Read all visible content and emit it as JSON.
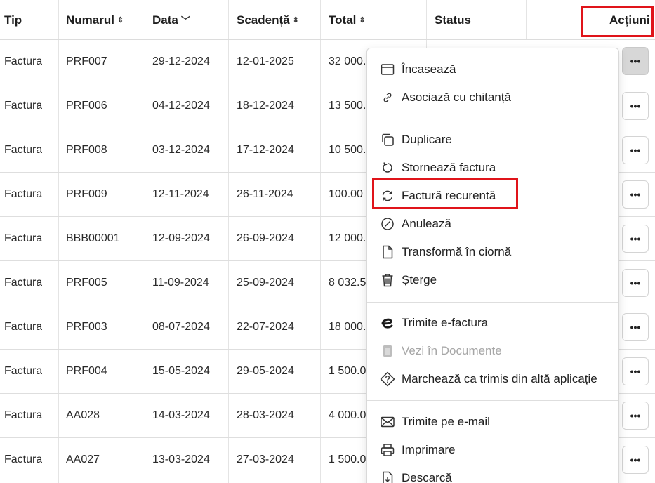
{
  "columns": {
    "tip": "Tip",
    "numarul": "Numarul",
    "data": "Data",
    "scadenta": "Scadență",
    "total": "Total",
    "status": "Status",
    "actiuni": "Acțiuni"
  },
  "rows": [
    {
      "tip": "Factura",
      "numar": "PRF007",
      "data": "29-12-2024",
      "scadenta": "12-01-2025",
      "total": "32 000."
    },
    {
      "tip": "Factura",
      "numar": "PRF006",
      "data": "04-12-2024",
      "scadenta": "18-12-2024",
      "total": "13 500."
    },
    {
      "tip": "Factura",
      "numar": "PRF008",
      "data": "03-12-2024",
      "scadenta": "17-12-2024",
      "total": "10 500."
    },
    {
      "tip": "Factura",
      "numar": "PRF009",
      "data": "12-11-2024",
      "scadenta": "26-11-2024",
      "total": "100.00"
    },
    {
      "tip": "Factura",
      "numar": "BBB00001",
      "data": "12-09-2024",
      "scadenta": "26-09-2024",
      "total": "12 000."
    },
    {
      "tip": "Factura",
      "numar": "PRF005",
      "data": "11-09-2024",
      "scadenta": "25-09-2024",
      "total": "8 032.5"
    },
    {
      "tip": "Factura",
      "numar": "PRF003",
      "data": "08-07-2024",
      "scadenta": "22-07-2024",
      "total": "18 000."
    },
    {
      "tip": "Factura",
      "numar": "PRF004",
      "data": "15-05-2024",
      "scadenta": "29-05-2024",
      "total": "1 500.0"
    },
    {
      "tip": "Factura",
      "numar": "AA028",
      "data": "14-03-2024",
      "scadenta": "28-03-2024",
      "total": "4 000.0"
    },
    {
      "tip": "Factura",
      "numar": "AA027",
      "data": "13-03-2024",
      "scadenta": "27-03-2024",
      "total": "1 500.0"
    }
  ],
  "row_actions_label": "•••",
  "menu": {
    "incaseaza": "Încasează",
    "asociaza": "Asociază cu chitanță",
    "duplicare": "Duplicare",
    "storneaza": "Stornează factura",
    "recurenta": "Factură recurentă",
    "anuleaza": "Anulează",
    "transforma": "Transformă în ciornă",
    "sterge": "Șterge",
    "efactura": "Trimite e-factura",
    "vezi_documente": "Vezi în Documente",
    "marcheaza": "Marchează ca trimis din altă aplicație",
    "email": "Trimite pe e-mail",
    "imprimare": "Imprimare",
    "descarca": "Descarcă"
  },
  "colors": {
    "highlight": "#e0141a",
    "active_button": "#d7d7d7",
    "disabled_text": "#a6a6a6"
  }
}
